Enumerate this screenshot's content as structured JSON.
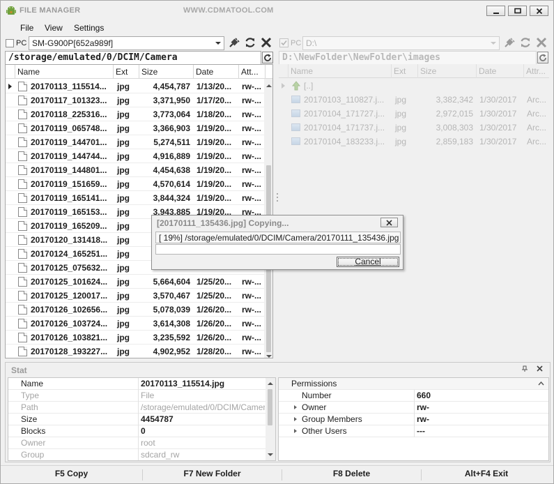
{
  "window": {
    "title": "FILE MANAGER",
    "site": "WWW.CDMATOOL.COM",
    "accent": "#6fa03c"
  },
  "menu": [
    {
      "label": "File"
    },
    {
      "label": "View"
    },
    {
      "label": "Settings"
    }
  ],
  "left": {
    "pc_label": "PC",
    "device": "SM-G900P[652a989f]",
    "path": "/storage/emulated/0/DCIM/Camera",
    "columns": [
      "Name",
      "Ext",
      "Size",
      "Date",
      "Att..."
    ],
    "rows": [
      {
        "name": "20170113_115514...",
        "ext": "jpg",
        "size": "4,454,787",
        "date": "1/13/20...",
        "attr": "rw-...",
        "current": true
      },
      {
        "name": "20170117_101323...",
        "ext": "jpg",
        "size": "3,371,950",
        "date": "1/17/20...",
        "attr": "rw-..."
      },
      {
        "name": "20170118_225316...",
        "ext": "jpg",
        "size": "3,773,064",
        "date": "1/18/20...",
        "attr": "rw-..."
      },
      {
        "name": "20170119_065748...",
        "ext": "jpg",
        "size": "3,366,903",
        "date": "1/19/20...",
        "attr": "rw-..."
      },
      {
        "name": "20170119_144701...",
        "ext": "jpg",
        "size": "5,274,511",
        "date": "1/19/20...",
        "attr": "rw-..."
      },
      {
        "name": "20170119_144744...",
        "ext": "jpg",
        "size": "4,916,889",
        "date": "1/19/20...",
        "attr": "rw-..."
      },
      {
        "name": "20170119_144801...",
        "ext": "jpg",
        "size": "4,454,638",
        "date": "1/19/20...",
        "attr": "rw-..."
      },
      {
        "name": "20170119_151659...",
        "ext": "jpg",
        "size": "4,570,614",
        "date": "1/19/20...",
        "attr": "rw-..."
      },
      {
        "name": "20170119_165141...",
        "ext": "jpg",
        "size": "3,844,324",
        "date": "1/19/20...",
        "attr": "rw-..."
      },
      {
        "name": "20170119_165153...",
        "ext": "jpg",
        "size": "3,943,885",
        "date": "1/19/20...",
        "attr": "rw-..."
      },
      {
        "name": "20170119_165209...",
        "ext": "jpg",
        "size": "",
        "date": "",
        "attr": ""
      },
      {
        "name": "20170120_131418...",
        "ext": "jpg",
        "size": "",
        "date": "",
        "attr": ""
      },
      {
        "name": "20170124_165251...",
        "ext": "jpg",
        "size": "",
        "date": "",
        "attr": ""
      },
      {
        "name": "20170125_075632...",
        "ext": "jpg",
        "size": "",
        "date": "",
        "attr": ""
      },
      {
        "name": "20170125_101624...",
        "ext": "jpg",
        "size": "5,664,604",
        "date": "1/25/20...",
        "attr": "rw-..."
      },
      {
        "name": "20170125_120017...",
        "ext": "jpg",
        "size": "3,570,467",
        "date": "1/25/20...",
        "attr": "rw-..."
      },
      {
        "name": "20170126_102656...",
        "ext": "jpg",
        "size": "5,078,039",
        "date": "1/26/20...",
        "attr": "rw-..."
      },
      {
        "name": "20170126_103724...",
        "ext": "jpg",
        "size": "3,614,308",
        "date": "1/26/20...",
        "attr": "rw-..."
      },
      {
        "name": "20170126_103821...",
        "ext": "jpg",
        "size": "3,235,592",
        "date": "1/26/20...",
        "attr": "rw-..."
      },
      {
        "name": "20170128_193227...",
        "ext": "jpg",
        "size": "4,902,952",
        "date": "1/28/20...",
        "attr": "rw-..."
      }
    ]
  },
  "right": {
    "pc_label": "PC",
    "drive": "D:\\",
    "path": "D:\\NewFolder\\NewFolder\\images",
    "columns": [
      "Name",
      "Ext",
      "Size",
      "Date",
      "Attr..."
    ],
    "up_label": "[..]",
    "rows": [
      {
        "name": "20170103_110827.j...",
        "ext": "jpg",
        "size": "3,382,342",
        "date": "1/30/2017",
        "attr": "Arc..."
      },
      {
        "name": "20170104_171727.j...",
        "ext": "jpg",
        "size": "2,972,015",
        "date": "1/30/2017",
        "attr": "Arc..."
      },
      {
        "name": "20170104_171737.j...",
        "ext": "jpg",
        "size": "3,008,303",
        "date": "1/30/2017",
        "attr": "Arc..."
      },
      {
        "name": "20170104_183233.j...",
        "ext": "jpg",
        "size": "2,859,183",
        "date": "1/30/2017",
        "attr": "Arc..."
      }
    ]
  },
  "dialog": {
    "title": "[20170111_135436.jpg] Copying...",
    "status": "[ 19%] /storage/emulated/0/DCIM/Camera/20170111_135436.jpg",
    "progress_percent": 19,
    "cancel_label": "Cancel"
  },
  "stat": {
    "title": "Stat",
    "left_props": [
      {
        "key": "Name",
        "value": "20170113_115514.jpg",
        "bold": true
      },
      {
        "key": "Type",
        "value": "File",
        "bold": false
      },
      {
        "key": "Path",
        "value": "/storage/emulated/0/DCIM/Camer...",
        "bold": false
      },
      {
        "key": "Size",
        "value": "4454787",
        "bold": true
      },
      {
        "key": "Blocks",
        "value": "0",
        "bold": true
      },
      {
        "key": "Owner",
        "value": "root",
        "bold": false
      },
      {
        "key": "Group",
        "value": "sdcard_rw",
        "bold": false
      }
    ],
    "permissions_label": "Permissions",
    "right_props": [
      {
        "key": "Number",
        "value": "660",
        "expandable": false
      },
      {
        "key": "Owner",
        "value": "rw-",
        "expandable": true
      },
      {
        "key": "Group Members",
        "value": "rw-",
        "expandable": true
      },
      {
        "key": "Other Users",
        "value": "---",
        "expandable": true
      }
    ]
  },
  "fkeys": [
    {
      "label": "F5 Copy"
    },
    {
      "label": "F7 New Folder"
    },
    {
      "label": "F8 Delete"
    },
    {
      "label": "Alt+F4 Exit"
    }
  ]
}
